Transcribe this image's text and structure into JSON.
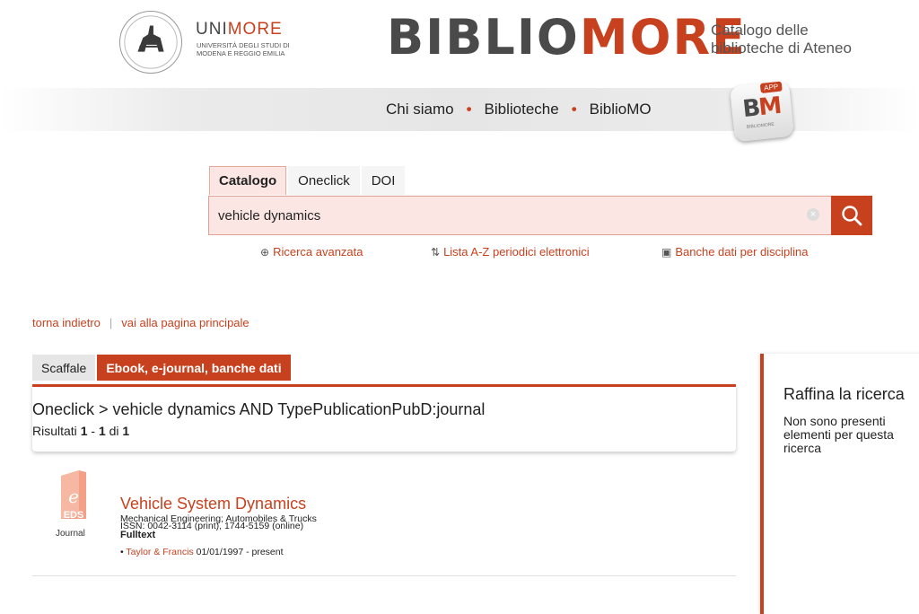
{
  "header": {
    "unimore_part1": "UNI",
    "unimore_part2": "MORE",
    "unimore_sub_line1": "UNIVERSITÀ DEGLI STUDI DI",
    "unimore_sub_line2": "MODENA E REGGIO EMILIA",
    "brand_part1": "BIBLIO",
    "brand_part2": "MORE",
    "brand_sub_line1": "Catalogo delle",
    "brand_sub_line2": "biblioteche di Ateneo"
  },
  "nav": {
    "items": [
      "Chi siamo",
      "Biblioteche",
      "BiblioMO"
    ],
    "app_badge_label": "APP",
    "app_badge_logo1": "B",
    "app_badge_logo2": "M",
    "app_badge_sub": "BIBLIOMORE"
  },
  "search": {
    "tabs": [
      "Catalogo",
      "Oneclick",
      "DOI"
    ],
    "active_tab": "Catalogo",
    "value": "vehicle dynamics",
    "clear_glyph": "×",
    "links": [
      "Ricerca avanzata",
      "Lista A-Z periodici elettronici",
      "Banche dati per disciplina"
    ]
  },
  "breadcrumbs": {
    "back": "torna indietro",
    "home": "vai alla pagina principale"
  },
  "results": {
    "tabs": [
      "Scaffale",
      "Ebook, e-journal, banche dati"
    ],
    "active_tab": "Ebook, e-journal, banche dati",
    "query": "Oneclick >  vehicle dynamics AND TypePublicationPubD:journal",
    "count_prefix": "Risultati ",
    "count_from": "1",
    "count_dash": " - ",
    "count_to": "1",
    "count_of": " di ",
    "count_total": "1",
    "items": [
      {
        "type_label": "Journal",
        "icon_text": "EDS",
        "title": "Vehicle System Dynamics",
        "issn": "ISSN: 0042-3114 (print), 1744-5159 (online)",
        "subjects": "Mechanical Engineering; Automobiles & Trucks",
        "fulltext_label": "Fulltext",
        "provider": "Taylor & Francis",
        "coverage": "01/01/1997 - present"
      }
    ]
  },
  "refine": {
    "title": "Raffina la ricerca",
    "text": "Non sono presenti elementi per questa ricerca"
  },
  "colors": {
    "accent": "#c8411f",
    "search_bg": "#fbe6e3"
  }
}
